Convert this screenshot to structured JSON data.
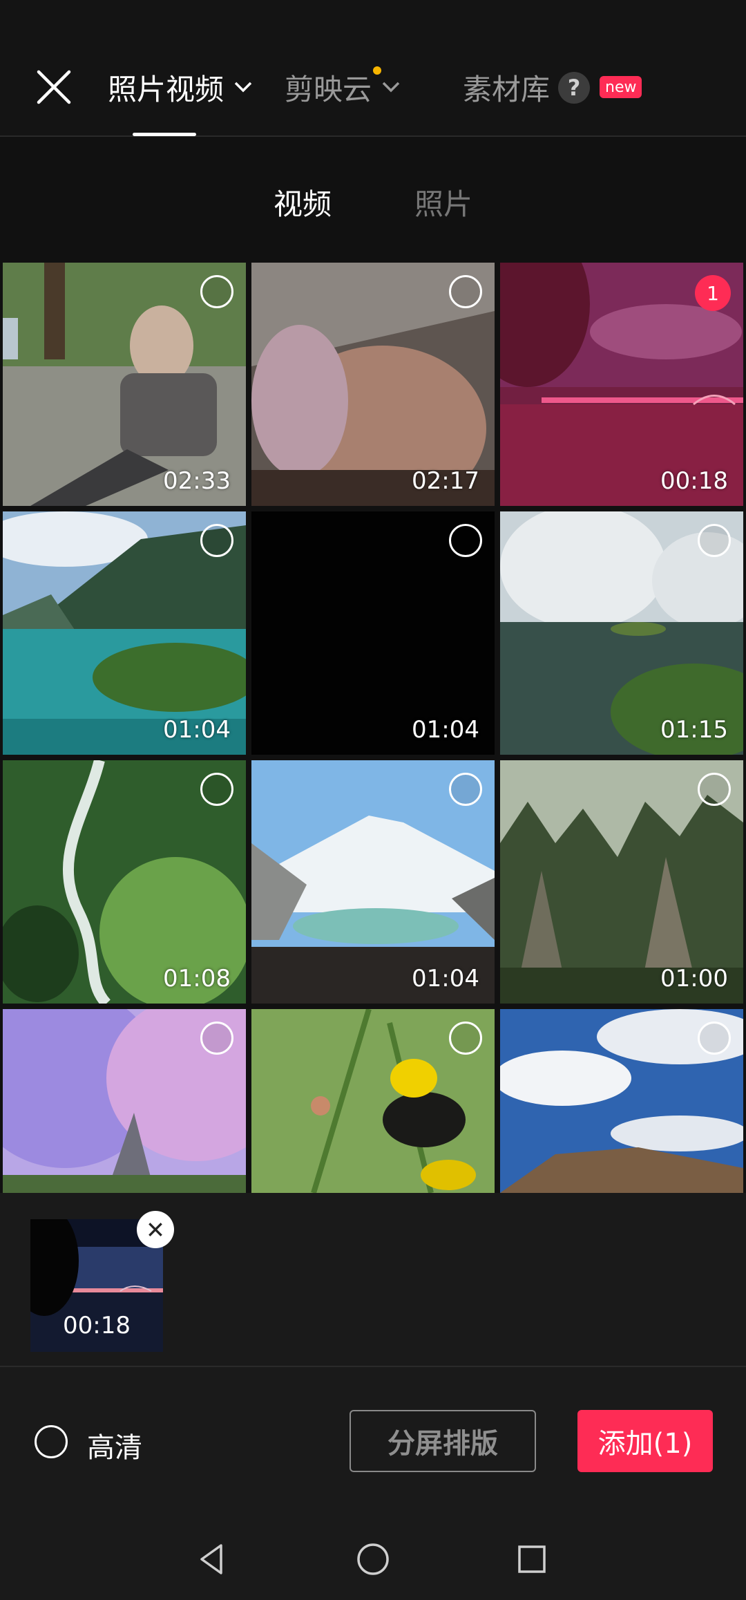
{
  "header": {
    "tabs": [
      {
        "label": "照片视频",
        "active": true,
        "has_dropdown": true
      },
      {
        "label": "剪映云",
        "active": false,
        "has_dropdown": true,
        "has_dot": true
      },
      {
        "label": "素材库",
        "active": false,
        "help": "?",
        "badge": "new"
      }
    ]
  },
  "subtabs": [
    {
      "label": "视频",
      "active": true
    },
    {
      "label": "照片",
      "active": false
    }
  ],
  "media": [
    {
      "scene": "old-man",
      "duration": "02:33",
      "selected": false
    },
    {
      "scene": "closeup",
      "duration": "02:17",
      "selected": false
    },
    {
      "scene": "night-lake",
      "duration": "00:18",
      "selected": true,
      "order": "1"
    },
    {
      "scene": "fjord",
      "duration": "01:04",
      "selected": false
    },
    {
      "scene": "black",
      "duration": "01:04",
      "selected": false
    },
    {
      "scene": "steam-lake",
      "duration": "01:15",
      "selected": false
    },
    {
      "scene": "forest-river",
      "duration": "01:08",
      "selected": false
    },
    {
      "scene": "snow-mountain",
      "duration": "01:04",
      "selected": false
    },
    {
      "scene": "karst-peaks",
      "duration": "01:00",
      "selected": false
    },
    {
      "scene": "cherry-blossom",
      "duration": "",
      "selected": false
    },
    {
      "scene": "bird",
      "duration": "",
      "selected": false
    },
    {
      "scene": "sky-hills",
      "duration": "",
      "selected": false
    }
  ],
  "selected_strip": {
    "items": [
      {
        "scene": "night-lake",
        "duration": "00:18"
      }
    ]
  },
  "footer": {
    "hd_label": "高清",
    "split_label": "分屏排版",
    "add_label": "添加(1)"
  },
  "colors": {
    "accent": "#fe2c55",
    "background": "#111111",
    "dot": "#f7b500"
  },
  "icons": [
    "close-icon",
    "chevron-down-icon",
    "help-icon",
    "back-icon",
    "home-icon",
    "recents-icon"
  ]
}
